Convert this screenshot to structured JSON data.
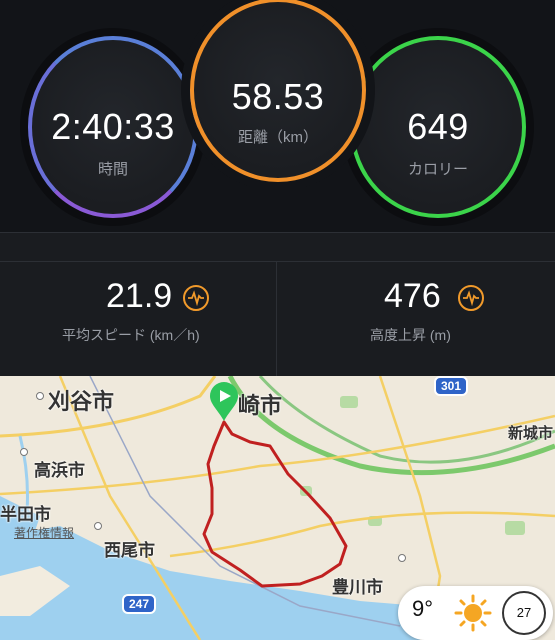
{
  "rings": {
    "time": {
      "value": "2:40:33",
      "label": "時間",
      "color": "#5a7fd8"
    },
    "distance": {
      "value": "58.53",
      "label": "距離（km）",
      "color": "#f0902a"
    },
    "calories": {
      "value": "649",
      "label": "カロリー",
      "color": "#3bd44a"
    }
  },
  "stats": {
    "speed": {
      "value": "21.9",
      "label": "平均スピード (km／h)"
    },
    "elevation": {
      "value": "476",
      "label": "高度上昇 (m)"
    }
  },
  "map": {
    "cities": {
      "kariya": "刈谷市",
      "okazaki": "崎市",
      "takahama": "高浜市",
      "handa": "半田市",
      "nishio": "西尾市",
      "toyokawa": "豊川市",
      "shinshiro": "新城市",
      "copyright": "著作権情報"
    },
    "routes": {
      "r301": "301",
      "r247": "247"
    },
    "route_color": "#c02020"
  },
  "weather": {
    "temp": "9°",
    "icon": "sun-icon",
    "aqi": "27"
  }
}
